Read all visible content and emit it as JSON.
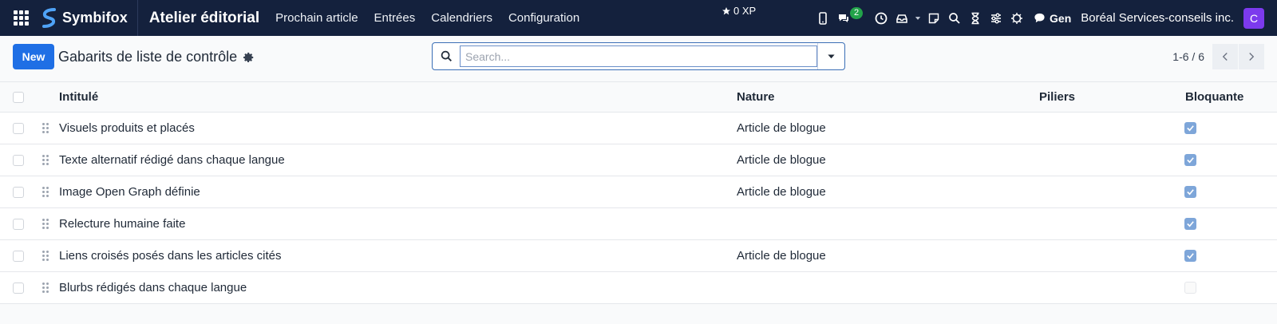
{
  "navbar": {
    "brand": "Symbifox",
    "app_title": "Atelier éditorial",
    "menu": [
      "Prochain article",
      "Entrées",
      "Calendriers",
      "Configuration"
    ],
    "xp": "0 XP",
    "chat_badge": "2",
    "gen": "Gen",
    "company": "Boréal Services-conseils inc.",
    "avatar_letter": "C",
    "avatar_color": "#7c3aed"
  },
  "control": {
    "new_label": "New",
    "title": "Gabarits de liste de contrôle",
    "search_placeholder": "Search...",
    "pager": "1-6 / 6"
  },
  "table": {
    "columns": [
      "Intitulé",
      "Nature",
      "Piliers",
      "Bloquante"
    ],
    "rows": [
      {
        "name": "Visuels produits et placés",
        "nature": "Article de blogue",
        "piliers": "",
        "bloquante": true
      },
      {
        "name": "Texte alternatif rédigé dans chaque langue",
        "nature": "Article de blogue",
        "piliers": "",
        "bloquante": true
      },
      {
        "name": "Image Open Graph définie",
        "nature": "Article de blogue",
        "piliers": "",
        "bloquante": true
      },
      {
        "name": "Relecture humaine faite",
        "nature": "",
        "piliers": "",
        "bloquante": true
      },
      {
        "name": "Liens croisés posés dans les articles cités",
        "nature": "Article de blogue",
        "piliers": "",
        "bloquante": true
      },
      {
        "name": "Blurbs rédigés dans chaque langue",
        "nature": "",
        "piliers": "",
        "bloquante": false
      }
    ]
  },
  "colors": {
    "navbar_bg": "#14213d",
    "primary": "#1f6fe5",
    "check_on": "#7ea6d9"
  }
}
